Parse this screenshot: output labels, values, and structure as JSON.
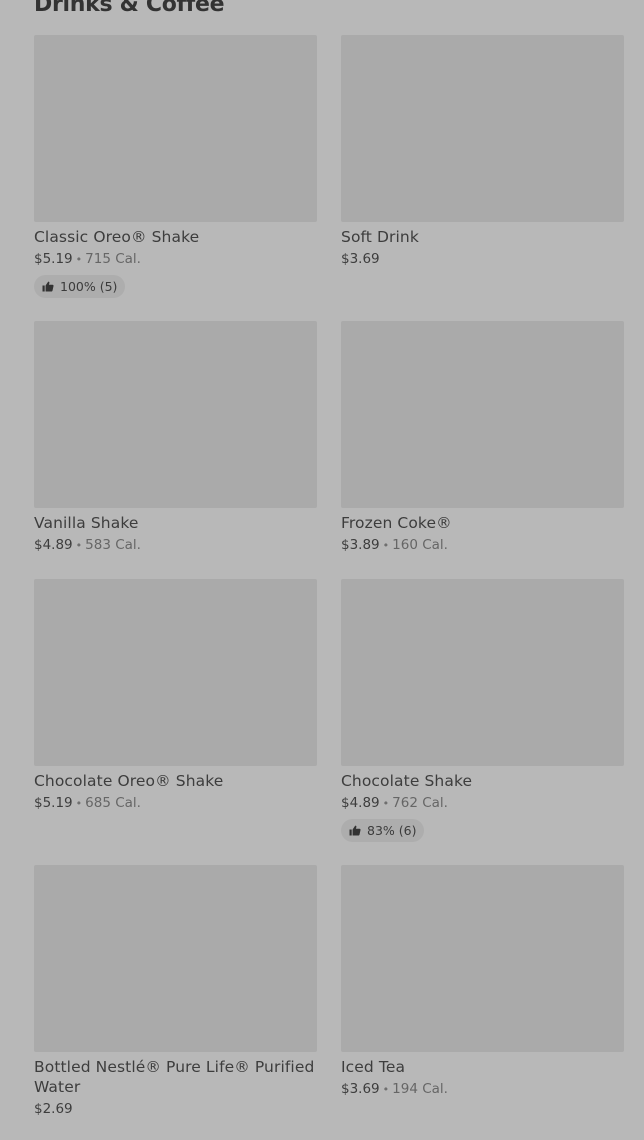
{
  "section": {
    "title": "Drinks & Coffee"
  },
  "items": [
    {
      "name": "Classic Oreo® Shake",
      "price": "$5.19",
      "cal": "715 Cal.",
      "rating": "100% (5)"
    },
    {
      "name": "Soft Drink",
      "price": "$3.69"
    },
    {
      "name": "Vanilla Shake",
      "price": "$4.89",
      "cal": "583 Cal."
    },
    {
      "name": "Frozen Coke®",
      "price": "$3.89",
      "cal": "160 Cal."
    },
    {
      "name": "Chocolate Oreo® Shake",
      "price": "$5.19",
      "cal": "685 Cal."
    },
    {
      "name": "Chocolate Shake",
      "price": "$4.89",
      "cal": "762 Cal.",
      "rating": "83% (6)"
    },
    {
      "name": "Bottled Nestlé® Pure Life® Purified Water",
      "price": "$2.69"
    },
    {
      "name": "Iced Tea",
      "price": "$3.69",
      "cal": "194 Cal."
    }
  ],
  "separator": "•",
  "icons": {
    "rating": "thumbs-up-icon"
  }
}
